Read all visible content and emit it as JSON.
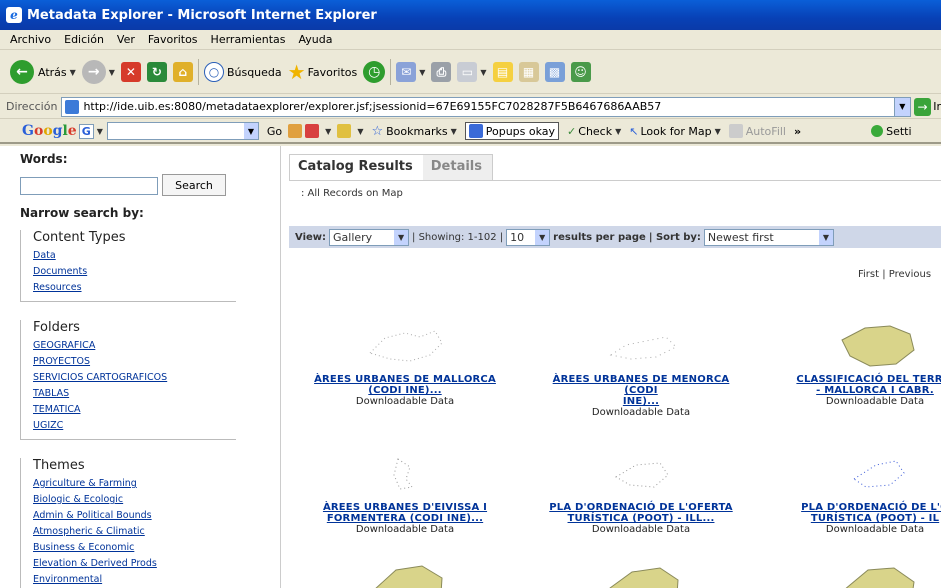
{
  "window": {
    "title": "Metadata Explorer - Microsoft Internet Explorer"
  },
  "menu": [
    "Archivo",
    "Edición",
    "Ver",
    "Favoritos",
    "Herramientas",
    "Ayuda"
  ],
  "toolbar": {
    "back": "Atrás",
    "search": "Búsqueda",
    "favorites": "Favoritos"
  },
  "address": {
    "label": "Dirección",
    "url": "http://ide.uib.es:8080/metadataexplorer/explorer.jsf;jsessionid=67E69155FC7028287F5B6467686AAB57",
    "go": "Ir"
  },
  "googlebar": {
    "logo": "Google",
    "g": "G",
    "go": "Go",
    "bookmarks": "Bookmarks",
    "popups": "Popups okay",
    "check": "Check",
    "lookformap": "Look for Map",
    "autofill": "AutoFill",
    "more": "»",
    "settings": "Setti"
  },
  "sidebar": {
    "words_label": "Words:",
    "search_button": "Search",
    "narrow_label": "Narrow search by:",
    "content_types": {
      "title": "Content Types",
      "items": [
        "Data",
        "Documents",
        "Resources"
      ]
    },
    "folders": {
      "title": "Folders",
      "items": [
        "GEOGRAFICA",
        "PROYECTOS",
        "SERVICIOS CARTOGRAFICOS",
        "TABLAS",
        "TEMATICA",
        "UGIZC"
      ]
    },
    "themes": {
      "title": "Themes",
      "items": [
        "Agriculture & Farming",
        "Biologic & Ecologic",
        "Admin & Political Bounds",
        "Atmospheric & Climatic",
        "Business & Economic",
        "Elevation & Derived Prods",
        "Environmental"
      ]
    }
  },
  "main": {
    "tabs": [
      "Catalog Results",
      "Details"
    ],
    "on_map": ": All Records on Map",
    "view_label": "View:",
    "view_value": "Gallery",
    "showing": "| Showing: 1-102 |",
    "per_page": "10",
    "per_page_label": "results per page",
    "sort_label": "| Sort by:",
    "sort_value": "Newest first",
    "pager": "First | Previous",
    "results": [
      {
        "title1": "ÀREES URBANES DE MALLORCA",
        "title2": "(CODI INE)...",
        "sub": "Downloadable Data"
      },
      {
        "title1": "ÀREES URBANES DE MENORCA (CODI",
        "title2": "INE)...",
        "sub": "Downloadable Data"
      },
      {
        "title1": "CLASSIFICACIÓ DEL TERRIT",
        "title2": "- MALLORCA I CABR.",
        "sub": "Downloadable Data"
      },
      {
        "title1": "ÀREES URBANES D'EIVISSA I",
        "title2": "FORMENTERA (CODI INE)...",
        "sub": "Downloadable Data"
      },
      {
        "title1": "PLA D'ORDENACIÓ DE L'OFERTA",
        "title2": "TURÍSTICA (POOT) - ILL...",
        "sub": "Downloadable Data"
      },
      {
        "title1": "PLA D'ORDENACIÓ DE L'O",
        "title2": "TURÍSTICA (POOT) - IL",
        "sub": "Downloadable Data"
      }
    ]
  },
  "colors": {
    "titlebar": "#0a4fc8",
    "link": "#003399",
    "viewbar": "#cfd7e8"
  }
}
